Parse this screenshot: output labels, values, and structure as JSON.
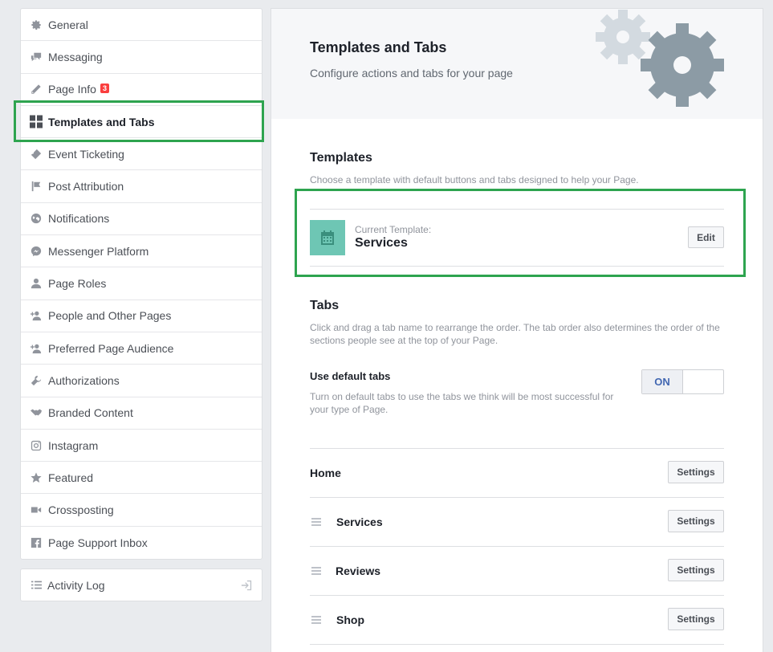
{
  "sidebar": {
    "items": [
      {
        "label": "General",
        "icon": "gear-icon"
      },
      {
        "label": "Messaging",
        "icon": "messages-icon"
      },
      {
        "label": "Page Info",
        "icon": "pencil-icon",
        "badge": "3"
      },
      {
        "label": "Templates and Tabs",
        "icon": "grid-icon",
        "active": true
      },
      {
        "label": "Event Ticketing",
        "icon": "ticket-icon"
      },
      {
        "label": "Post Attribution",
        "icon": "flag-icon"
      },
      {
        "label": "Notifications",
        "icon": "globe-icon"
      },
      {
        "label": "Messenger Platform",
        "icon": "messenger-icon"
      },
      {
        "label": "Page Roles",
        "icon": "person-icon"
      },
      {
        "label": "People and Other Pages",
        "icon": "person-plus-icon"
      },
      {
        "label": "Preferred Page Audience",
        "icon": "person-plus-icon"
      },
      {
        "label": "Authorizations",
        "icon": "wrench-icon"
      },
      {
        "label": "Branded Content",
        "icon": "handshake-icon"
      },
      {
        "label": "Instagram",
        "icon": "instagram-icon"
      },
      {
        "label": "Featured",
        "icon": "star-icon"
      },
      {
        "label": "Crossposting",
        "icon": "video-camera-icon"
      },
      {
        "label": "Page Support Inbox",
        "icon": "facebook-icon"
      }
    ],
    "activity_log": {
      "label": "Activity Log",
      "icon": "list-icon",
      "action_icon": "exit-icon"
    }
  },
  "header": {
    "title": "Templates and Tabs",
    "subtitle": "Configure actions and tabs for your page",
    "decoration": "gears-icon"
  },
  "templates": {
    "title": "Templates",
    "description": "Choose a template with default buttons and tabs designed to help your Page.",
    "current_label": "Current Template:",
    "current_name": "Services",
    "edit_label": "Edit",
    "icon": "calendar-icon"
  },
  "tabs": {
    "title": "Tabs",
    "description": "Click and drag a tab name to rearrange the order. The tab order also determines the order of the sections people see at the top of your Page.",
    "use_default": {
      "title": "Use default tabs",
      "description": "Turn on default tabs to use the tabs we think will be most successful for your type of Page.",
      "toggle_label": "ON"
    },
    "items": [
      {
        "name": "Home",
        "settings_label": "Settings",
        "draggable": false
      },
      {
        "name": "Services",
        "settings_label": "Settings",
        "draggable": true
      },
      {
        "name": "Reviews",
        "settings_label": "Settings",
        "draggable": true
      },
      {
        "name": "Shop",
        "settings_label": "Settings",
        "draggable": true
      }
    ]
  },
  "colors": {
    "highlight": "#2ea44f",
    "template_icon_bg": "#6ec6b4",
    "toggle_on": "#4267b2",
    "badge": "#fa3e3e"
  }
}
